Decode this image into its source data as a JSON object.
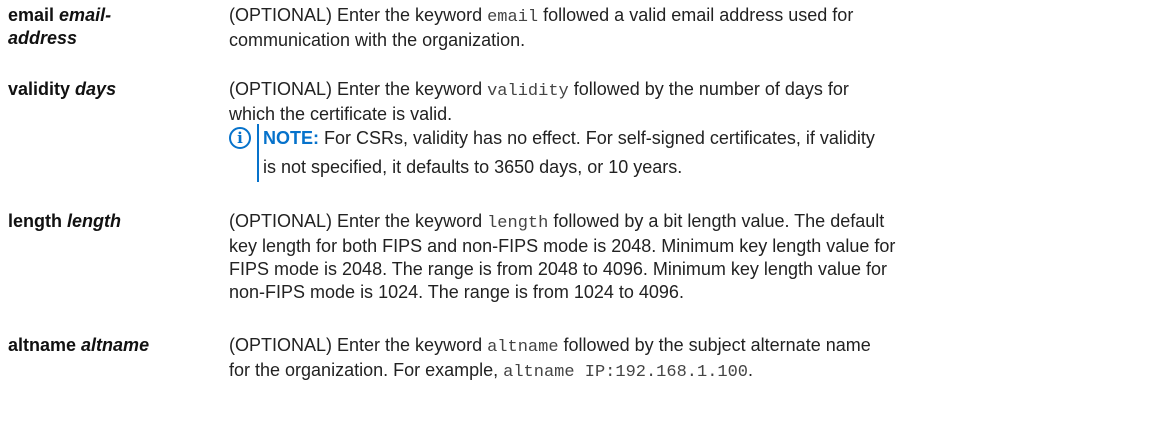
{
  "rows": [
    {
      "term_keyword": "email",
      "term_param_line1": "email-",
      "term_param_line2": "address",
      "desc_prefix": "(OPTIONAL) Enter the keyword",
      "desc_code": "email",
      "desc_line1_suffix": "followed a valid email address used for",
      "desc_line2": "communication with the organization."
    },
    {
      "term_keyword": "validity",
      "term_param": "days",
      "desc_prefix": "(OPTIONAL) Enter the keyword",
      "desc_code": "validity",
      "desc_line1_suffix": "followed by the number of days for",
      "desc_line2": "which the certificate is valid.",
      "note": {
        "icon": "info-circle-icon",
        "label": "NOTE:",
        "line1": "For CSRs, validity has no effect. For self-signed certificates, if validity",
        "line2": "is not specified, it defaults to 3650 days, or 10 years."
      }
    },
    {
      "term_keyword": "length",
      "term_param": "length",
      "desc_prefix": "(OPTIONAL) Enter the keyword",
      "desc_code": "length",
      "desc_line1_suffix": "followed by a bit length value. The default",
      "desc_line2": "key length for both FIPS and non-FIPS mode is 2048. Minimum key length value for",
      "desc_line3": "FIPS mode is 2048. The range is from 2048 to 4096. Minimum key length value for",
      "desc_line4": "non-FIPS mode is 1024. The range is from 1024 to 4096."
    },
    {
      "term_keyword": "altname",
      "term_param": "altname",
      "desc_prefix": "(OPTIONAL) Enter the keyword",
      "desc_code": "altname",
      "desc_line1_suffix": "followed by the subject alternate name",
      "desc_line2_prefix": "for the organization. For example,",
      "desc_line2_code": "altname IP:192.168.1.100",
      "desc_line2_suffix": "."
    }
  ],
  "colors": {
    "text": "#222222",
    "note_accent": "#0672cb",
    "code": "#444444"
  }
}
